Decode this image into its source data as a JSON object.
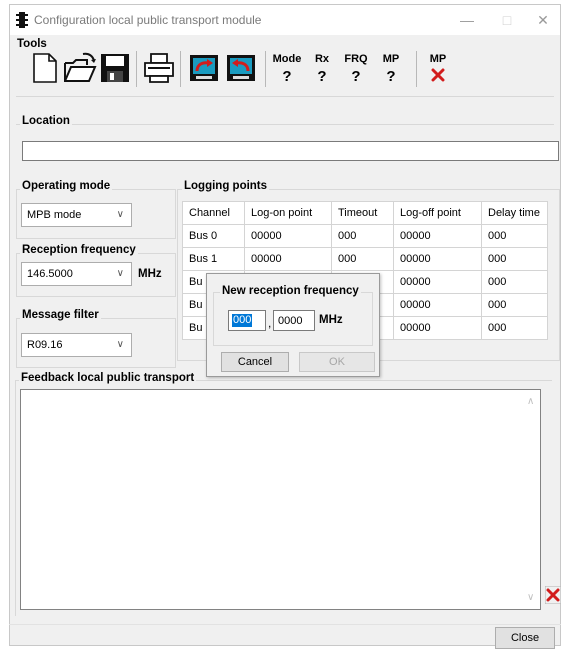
{
  "window": {
    "title": "Configuration local public transport module"
  },
  "titlebar": {
    "minimize": "—",
    "maximize": "□",
    "close": "✕"
  },
  "tools": {
    "group_label": "Tools",
    "status": [
      {
        "label": "Mode",
        "value": "?"
      },
      {
        "label": "Rx",
        "value": "?"
      },
      {
        "label": "FRQ",
        "value": "?"
      },
      {
        "label": "MP",
        "value": "?"
      }
    ],
    "mp_label": "MP",
    "mp_status_icon": "red-x-icon"
  },
  "location": {
    "label": "Location",
    "value": ""
  },
  "operating_mode": {
    "label": "Operating mode",
    "selected": "MPB mode"
  },
  "reception_frequency": {
    "label": "Reception frequency",
    "selected": "146.5000",
    "unit": "MHz"
  },
  "message_filter": {
    "label": "Message filter",
    "selected": "R09.16"
  },
  "logging_points": {
    "label": "Logging points",
    "columns": [
      "Channel",
      "Log-on point",
      "Timeout",
      "Log-off point",
      "Delay time"
    ],
    "rows": [
      [
        "Bus 0",
        "00000",
        "000",
        "00000",
        "000"
      ],
      [
        "Bus 1",
        "00000",
        "000",
        "00000",
        "000"
      ],
      [
        "Bu",
        "",
        "",
        "00000",
        "000"
      ],
      [
        "Bu",
        "",
        "",
        "00000",
        "000"
      ],
      [
        "Bu",
        "",
        "",
        "00000",
        "000"
      ]
    ]
  },
  "dialog": {
    "title": "New reception frequency",
    "integer_value": "000",
    "separator": ",",
    "decimal_value": "0000",
    "unit": "MHz",
    "cancel_label": "Cancel",
    "ok_label": "OK"
  },
  "feedback": {
    "label": "Feedback local public transport",
    "value": ""
  },
  "footer": {
    "close_label": "Close"
  },
  "colors": {
    "accent_red": "#d21c1c",
    "selection_blue": "#0078d7"
  }
}
